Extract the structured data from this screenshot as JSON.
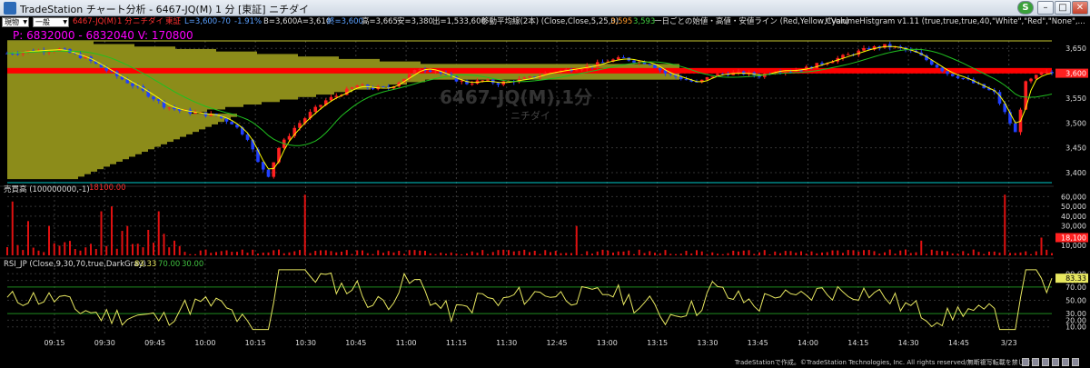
{
  "window": {
    "title": "TradeStation チャート分析 - 6467-JQ(M) 1 分 [東証] ニチダイ",
    "minimize": "–",
    "maximize": "□",
    "close": "✕",
    "s_badge": "S"
  },
  "toolbar": {
    "select1": "現物",
    "select2": "一般",
    "symbol": "6467-JQ(M)",
    "interval": "1 分",
    "name": "ニチダイ",
    "exchange": "東証",
    "last_label": "L=3,600",
    "change": "-70",
    "change_pct": "-1.91%",
    "bid": "B=3,600",
    "ask": "A=3,610",
    "close_label": "終=3,600",
    "high": "高=3,665",
    "low": "安=3,380",
    "volume": "出=1,533,600",
    "ma_study": "移動平均線(2本) (Close,Close,5,25,0)",
    "ma1_val": "3,595",
    "ma2_val": "3,593",
    "line_study": "一日ごとの始値・高値・安値ライン (Red,Yellow,Cyan)",
    "vh_study": "!!VolumeHistgram v1.11 (true,true,true,40,\"White\",\"Red\",\"None\",..."
  },
  "price_pane": {
    "poc_label": "P: 6832000 - 6832040 V: 170800",
    "watermark_symbol": "6467-JQ(M),1分",
    "watermark_name": "ニチダイ",
    "last_price_tag": "3,600",
    "y_ticks": [
      "3,650",
      "3,600",
      "3,550",
      "3,500",
      "3,450",
      "3,400"
    ]
  },
  "volume_pane": {
    "label": "売買高 (100000000,-1)",
    "value": "18100.00",
    "last_tag": "18,100",
    "y_ticks": [
      "60,000",
      "50,000",
      "40,000",
      "30,000",
      "20,000",
      "10,000"
    ]
  },
  "rsi_pane": {
    "label": "RSI_JP (Close,9,30,70,true,DarkGray)",
    "value": "83.33",
    "level_high": "70.00",
    "level_low": "30.00",
    "last_tag": "83.33",
    "y_ticks": [
      "90.00",
      "80.00",
      "70.00",
      "50.00",
      "30.00",
      "20.00",
      "10.00"
    ]
  },
  "time_axis": {
    "labels": [
      "09:15",
      "09:30",
      "09:45",
      "10:00",
      "10:15",
      "10:30",
      "10:45",
      "11:00",
      "11:15",
      "11:30",
      "12:45",
      "13:00",
      "13:15",
      "13:30",
      "13:45",
      "14:00",
      "14:15",
      "14:30",
      "14:45",
      "3/23"
    ]
  },
  "status": {
    "copyright": "TradeStationで作成。©TradeStation Technologies, Inc. All rights reserved/無断複写転載を禁じます。"
  },
  "colors": {
    "up": "#ff2020",
    "down": "#2040ff",
    "ma_fast": "#ffff00",
    "ma_slow": "#20c020",
    "volume_profile": "#8c8c1a",
    "rsi": "#e8e860",
    "open_line": "#ff0000",
    "low_line": "#00cccc"
  },
  "chart_data": {
    "type": "candlestick",
    "symbol": "6467-JQ(M)",
    "interval": "1 分",
    "price_range": [
      3380,
      3665
    ],
    "y_ticks_price": [
      3400,
      3450,
      3500,
      3550,
      3600,
      3650
    ],
    "close_path": [
      [
        0,
        3640
      ],
      [
        5,
        3645
      ],
      [
        10,
        3648
      ],
      [
        15,
        3630
      ],
      [
        20,
        3600
      ],
      [
        25,
        3570
      ],
      [
        28,
        3550
      ],
      [
        30,
        3535
      ],
      [
        33,
        3525
      ],
      [
        36,
        3520
      ],
      [
        40,
        3515
      ],
      [
        43,
        3500
      ],
      [
        46,
        3470
      ],
      [
        48,
        3420
      ],
      [
        50,
        3395
      ],
      [
        52,
        3450
      ],
      [
        55,
        3490
      ],
      [
        58,
        3520
      ],
      [
        61,
        3545
      ],
      [
        64,
        3560
      ],
      [
        67,
        3575
      ],
      [
        70,
        3570
      ],
      [
        73,
        3570
      ],
      [
        76,
        3590
      ],
      [
        79,
        3610
      ],
      [
        82,
        3605
      ],
      [
        85,
        3590
      ],
      [
        88,
        3580
      ],
      [
        91,
        3585
      ],
      [
        94,
        3580
      ],
      [
        97,
        3585
      ],
      [
        100,
        3590
      ],
      [
        103,
        3600
      ],
      [
        106,
        3605
      ],
      [
        109,
        3610
      ],
      [
        112,
        3615
      ],
      [
        115,
        3625
      ],
      [
        118,
        3630
      ],
      [
        120,
        3625
      ],
      [
        123,
        3620
      ],
      [
        126,
        3600
      ],
      [
        129,
        3590
      ],
      [
        132,
        3580
      ],
      [
        135,
        3595
      ],
      [
        138,
        3600
      ],
      [
        141,
        3600
      ],
      [
        144,
        3595
      ],
      [
        147,
        3605
      ],
      [
        150,
        3605
      ],
      [
        153,
        3610
      ],
      [
        156,
        3620
      ],
      [
        159,
        3630
      ],
      [
        162,
        3640
      ],
      [
        165,
        3650
      ],
      [
        168,
        3655
      ],
      [
        171,
        3650
      ],
      [
        174,
        3640
      ],
      [
        177,
        3620
      ],
      [
        180,
        3600
      ],
      [
        183,
        3590
      ],
      [
        186,
        3575
      ],
      [
        189,
        3560
      ],
      [
        192,
        3500
      ],
      [
        193,
        3480
      ],
      [
        195,
        3580
      ],
      [
        198,
        3600
      ],
      [
        200,
        3600
      ]
    ],
    "volume_spikes": [
      {
        "t": 1,
        "v": 55000
      },
      {
        "t": 4,
        "v": 35000
      },
      {
        "t": 8,
        "v": 30000
      },
      {
        "t": 18,
        "v": 45000
      },
      {
        "t": 20,
        "v": 50000
      },
      {
        "t": 22,
        "v": 25000
      },
      {
        "t": 23,
        "v": 30000
      },
      {
        "t": 27,
        "v": 26000
      },
      {
        "t": 29,
        "v": 45000
      },
      {
        "t": 30,
        "v": 22000
      },
      {
        "t": 32,
        "v": 15000
      },
      {
        "t": 57,
        "v": 62000
      },
      {
        "t": 109,
        "v": 30000
      },
      {
        "t": 175,
        "v": 15000
      },
      {
        "t": 191,
        "v": 62000
      },
      {
        "t": 198,
        "v": 18100
      }
    ],
    "volume_ticks": [
      10000,
      20000,
      30000,
      40000,
      50000,
      60000
    ],
    "rsi_range": [
      0,
      100
    ],
    "rsi_levels": [
      30,
      70
    ],
    "rsi_last": 83.33
  }
}
